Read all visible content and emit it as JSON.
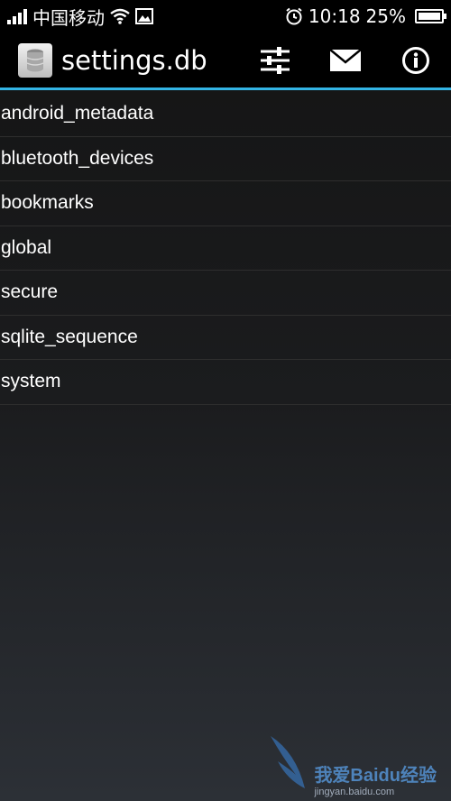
{
  "status_bar": {
    "carrier": "中国移动",
    "time": "10:18",
    "battery": "25%",
    "icons": [
      "signal-icon",
      "wifi-icon",
      "image-icon",
      "alarm-icon",
      "battery-icon"
    ]
  },
  "action_bar": {
    "title": "settings.db",
    "icons": [
      "database-icon",
      "filter-sliders-icon",
      "mail-icon",
      "info-icon"
    ],
    "accent": "#33b5e5"
  },
  "tables": [
    "android_metadata",
    "bluetooth_devices",
    "bookmarks",
    "global",
    "secure",
    "sqlite_sequence",
    "system"
  ],
  "watermark": {
    "text": "我爱Baidu经验",
    "url": "jingyan.baidu.com"
  }
}
